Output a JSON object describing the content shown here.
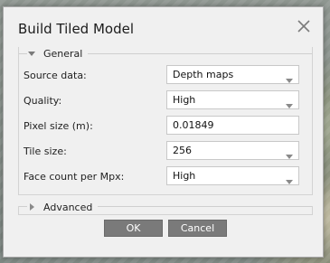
{
  "dialog": {
    "title": "Build Tiled Model",
    "close_icon": "close-icon"
  },
  "general": {
    "header": "General",
    "rows": [
      {
        "label": "Source data:",
        "value": "Depth maps",
        "type": "select"
      },
      {
        "label": "Quality:",
        "value": "High",
        "type": "select"
      },
      {
        "label": "Pixel size (m):",
        "value": "0.01849",
        "type": "input"
      },
      {
        "label": "Tile size:",
        "value": "256",
        "type": "select"
      },
      {
        "label": "Face count per Mpx:",
        "value": "High",
        "type": "select"
      }
    ]
  },
  "advanced": {
    "header": "Advanced"
  },
  "buttons": {
    "ok": "OK",
    "cancel": "Cancel"
  }
}
